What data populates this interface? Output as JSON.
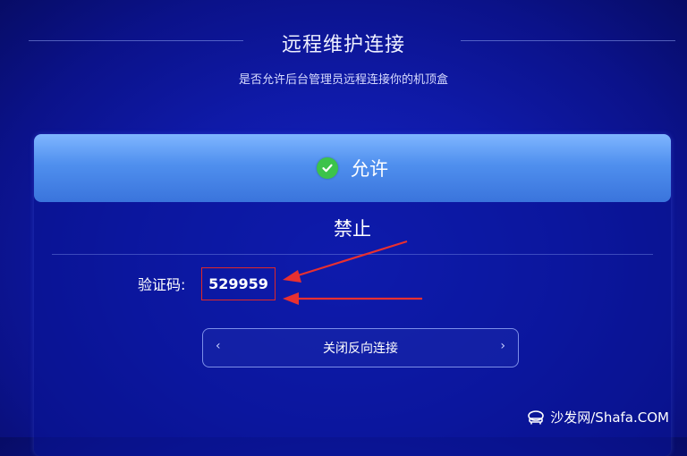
{
  "dialog": {
    "title": "远程维护连接",
    "subtitle": "是否允许后台管理员远程连接你的机顶盒"
  },
  "options": {
    "allow_label": "允许",
    "deny_label": "禁止",
    "selected": "allow"
  },
  "verification": {
    "label": "验证码:",
    "code": "529959"
  },
  "action_button": {
    "label": "关闭反向连接",
    "left_chevron": "‹",
    "right_chevron": "›"
  },
  "watermark": {
    "text": "沙发网/Shafa.COM"
  },
  "colors": {
    "background": "#0f1aa8",
    "selected_option": "#4f8fee",
    "check": "#3cc34a",
    "highlight_box": "#e02828",
    "arrow": "#e02828"
  }
}
